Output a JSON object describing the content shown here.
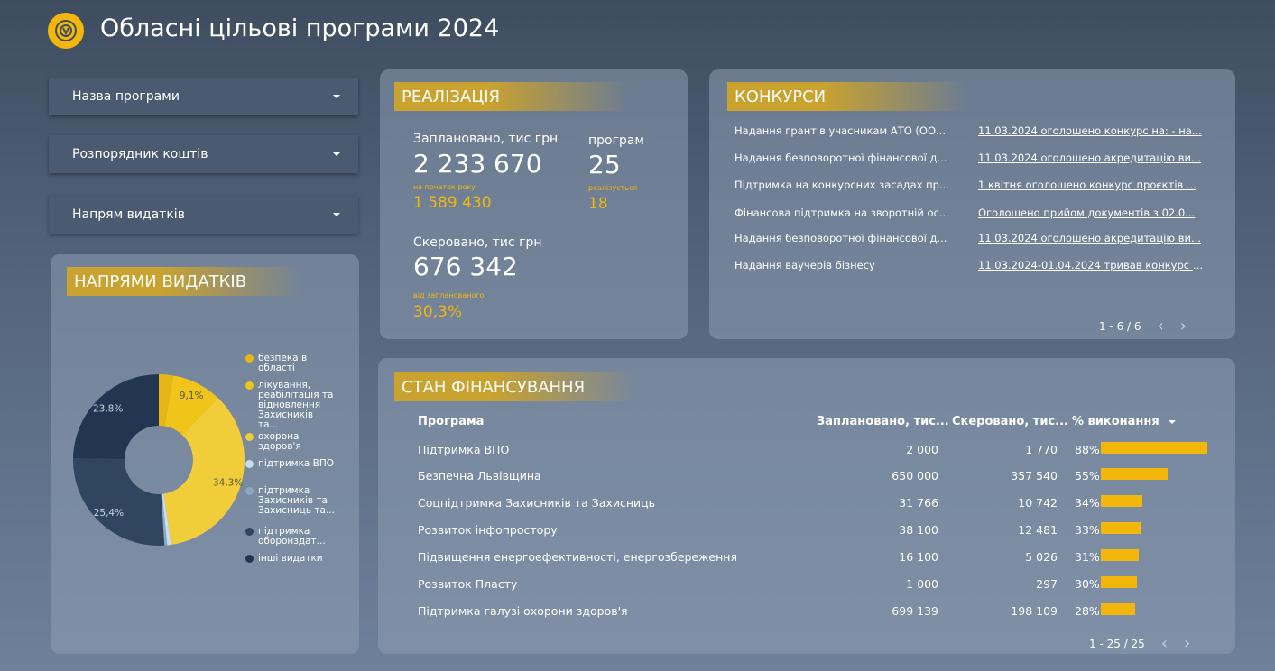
{
  "header": {
    "title": "Обласні цільові програми 2024"
  },
  "filters": [
    {
      "label": "Назва програми"
    },
    {
      "label": "Розпорядник коштів"
    },
    {
      "label": "Напрям видатків"
    }
  ],
  "realization": {
    "title": "РЕАЛІЗАЦІЯ",
    "planned_label": "Заплановано, тис грн",
    "planned_value": "2 233 670",
    "start_label": "на початок року",
    "start_value": "1 589 430",
    "programs_label": "програм",
    "programs_value": "25",
    "implemented_label": "реалізується",
    "implemented_value": "18",
    "sent_label": "Скеровано, тис грн",
    "sent_value": "676 342",
    "percent_label": "від запланованого",
    "percent_value": "30,3%"
  },
  "contests": {
    "title": "КОНКУРСИ",
    "rows": [
      {
        "name": "Надання грантів учасникам АТО (ОО...",
        "link": "11.03.2024 оголошено конкурс на: - на..."
      },
      {
        "name": "Надання безповоротної фінансової д...",
        "link": "11.03.2024 оголошено акредитацію ви..."
      },
      {
        "name": "Підтримка на конкурсних засадах пр...",
        "link": "1 квітня оголошено конкурс проєктів ..."
      },
      {
        "name": "Фінансова підтримка на зворотній ос...",
        "link": "Оголошено прийом документів з 02.0..."
      },
      {
        "name": "Надання безповоротної фінансової д...",
        "link": "11.03.2024 оголошено акредитацію ви..."
      },
      {
        "name": "Надання ваучерів бізнесу",
        "link": "11.03.2024-01.04.2024 тривав конкурс н..."
      }
    ],
    "pager": "1 - 6 / 6",
    "prev": "‹",
    "next": "›"
  },
  "directions": {
    "title": "НАПРЯМИ ВИДАТКІВ",
    "legend": [
      {
        "label": "безпека в області",
        "color": "#e8b516"
      },
      {
        "label": "лікування, реабілітація та відновлення Захисників та...",
        "color": "#f0c419"
      },
      {
        "label": "охорона здоров'я",
        "color": "#f2cd3a"
      },
      {
        "label": "підтримка ВПО",
        "color": "#c7def0"
      },
      {
        "label": "підтримка Захисників та Захисниць та...",
        "color": "#8fa6c1"
      },
      {
        "label": "підтримка оборонздат...",
        "color": "#2f4560"
      },
      {
        "label": "інші видатки",
        "color": "#233651"
      }
    ],
    "labels": {
      "p1": "9,1%",
      "p2": "34,3%",
      "p3": "25,4%",
      "p4": "23,8%"
    }
  },
  "chart_data": {
    "type": "pie",
    "categories": [
      "безпека в області",
      "лікування, реабілітація та відновлення Захисників та...",
      "охорона здоров'я",
      "підтримка ВПО",
      "підтримка Захисників та Захисниць та...",
      "підтримка оборонздат...",
      "інші видатки"
    ],
    "values": [
      2.6,
      9.1,
      34.3,
      0.7,
      0.5,
      25.4,
      23.8
    ],
    "colors": [
      "#e8b516",
      "#f0c419",
      "#f2cd3a",
      "#c7def0",
      "#8fa6c1",
      "#2f4560",
      "#233651"
    ],
    "data_labels": [
      "",
      "9,1%",
      "34,3%",
      "",
      "",
      "25,4%",
      "23,8%"
    ],
    "legend_position": "right"
  },
  "financing": {
    "title": "СТАН ФІНАНСУВАННЯ",
    "headers": {
      "program": "Програма",
      "planned": "Заплановано, тис...",
      "sent": "Скеровано, тис...",
      "percent": "% виконання"
    },
    "rows": [
      {
        "program": "Підтримка ВПО",
        "planned": "2 000",
        "sent": "1 770",
        "percent": "88%",
        "pct": 88
      },
      {
        "program": "Безпечна Львівщина",
        "planned": "650 000",
        "sent": "357 540",
        "percent": "55%",
        "pct": 55
      },
      {
        "program": "Соцпідтримка Захисників та Захисниць",
        "planned": "31 766",
        "sent": "10 742",
        "percent": "34%",
        "pct": 34
      },
      {
        "program": "Розвиток інфопростору",
        "planned": "38 100",
        "sent": "12 481",
        "percent": "33%",
        "pct": 33
      },
      {
        "program": "Підвищення енергоефективності, енергозбереження",
        "planned": "16 100",
        "sent": "5 026",
        "percent": "31%",
        "pct": 31
      },
      {
        "program": "Розвиток Пласту",
        "planned": "1 000",
        "sent": "297",
        "percent": "30%",
        "pct": 30
      },
      {
        "program": "Підтримка галузі охорони здоров'я",
        "planned": "699 139",
        "sent": "198 109",
        "percent": "28%",
        "pct": 28
      }
    ],
    "pager": "1 - 25 / 25",
    "prev": "‹",
    "next": "›"
  }
}
